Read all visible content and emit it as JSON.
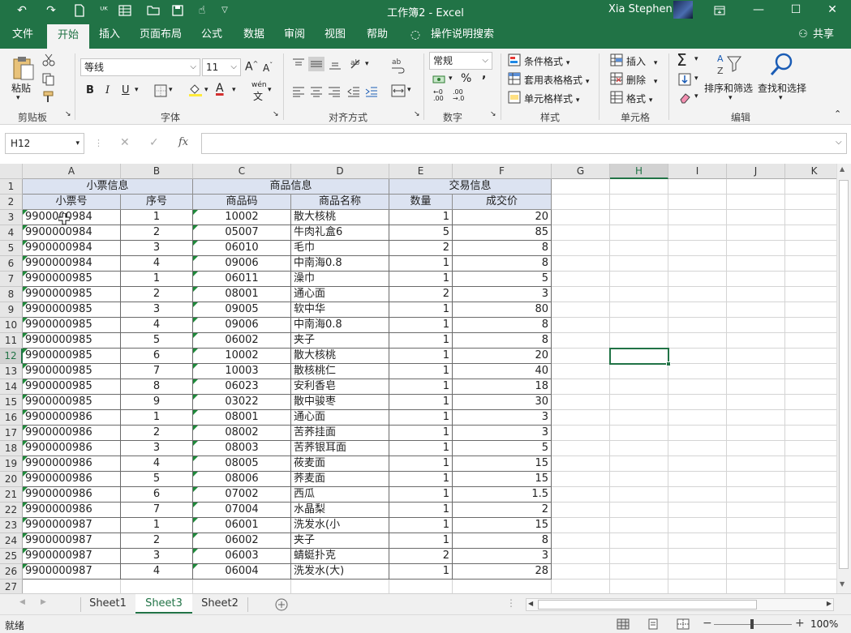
{
  "titlebar": {
    "title": "工作簿2  -  Excel",
    "user": "Xia Stephen",
    "minimize": "—",
    "restore": "☐",
    "close": "✕"
  },
  "tabs": [
    "文件",
    "开始",
    "插入",
    "页面布局",
    "公式",
    "数据",
    "审阅",
    "视图",
    "帮助"
  ],
  "tell_me": "操作说明搜索",
  "share": "共享",
  "ribbon": {
    "clipboard": {
      "paste": "粘贴",
      "label": "剪贴板"
    },
    "font": {
      "name": "等线",
      "size": "11",
      "label": "字体",
      "bold": "B",
      "italic": "I",
      "underline": "U",
      "grow": "A",
      "shrink": "A",
      "phonetic": "wén"
    },
    "alignment": {
      "label": "对齐方式"
    },
    "number": {
      "format": "常规",
      "label": "数字",
      "percent": "%",
      "comma": ",",
      "inc_dec": ".00",
      "dec_dec": ".00"
    },
    "styles": {
      "conditional": "条件格式",
      "table": "套用表格格式",
      "cell": "单元格样式",
      "label": "样式"
    },
    "cells": {
      "insert": "插入",
      "delete": "删除",
      "format": "格式",
      "label": "单元格"
    },
    "editing": {
      "sort": "排序和筛选",
      "find": "查找和选择",
      "label": "编辑"
    }
  },
  "formula_bar": {
    "name_box": "H12",
    "formula": ""
  },
  "columns": [
    "A",
    "B",
    "C",
    "D",
    "E",
    "F",
    "G",
    "H",
    "I",
    "J",
    "K"
  ],
  "selected_cell": "H12",
  "header_row1": [
    "小票信息",
    "商品信息",
    "交易信息"
  ],
  "header_row2": [
    "小票号",
    "序号",
    "商品码",
    "商品名称",
    "数量",
    "成交价"
  ],
  "rows": [
    [
      "9900000984",
      "1",
      "10002",
      "散大核桃",
      "1",
      "20"
    ],
    [
      "9900000984",
      "2",
      "05007",
      "牛肉礼盒6",
      "5",
      "85"
    ],
    [
      "9900000984",
      "3",
      "06010",
      "毛巾",
      "2",
      "8"
    ],
    [
      "9900000984",
      "4",
      "09006",
      "中南海0.8",
      "1",
      "8"
    ],
    [
      "9900000985",
      "1",
      "06011",
      "澡巾",
      "1",
      "5"
    ],
    [
      "9900000985",
      "2",
      "08001",
      "通心面",
      "2",
      "3"
    ],
    [
      "9900000985",
      "3",
      "09005",
      "软中华",
      "1",
      "80"
    ],
    [
      "9900000985",
      "4",
      "09006",
      "中南海0.8",
      "1",
      "8"
    ],
    [
      "9900000985",
      "5",
      "06002",
      "夹子",
      "1",
      "8"
    ],
    [
      "9900000985",
      "6",
      "10002",
      "散大核桃",
      "1",
      "20"
    ],
    [
      "9900000985",
      "7",
      "10003",
      "散核桃仁",
      "1",
      "40"
    ],
    [
      "9900000985",
      "8",
      "06023",
      "安利香皂",
      "1",
      "18"
    ],
    [
      "9900000985",
      "9",
      "03022",
      "散中骏枣",
      "1",
      "30"
    ],
    [
      "9900000986",
      "1",
      "08001",
      "通心面",
      "1",
      "3"
    ],
    [
      "9900000986",
      "2",
      "08002",
      "苦荞挂面",
      "1",
      "3"
    ],
    [
      "9900000986",
      "3",
      "08003",
      "苦荞银耳面",
      "1",
      "5"
    ],
    [
      "9900000986",
      "4",
      "08005",
      "莜麦面",
      "1",
      "15"
    ],
    [
      "9900000986",
      "5",
      "08006",
      "荞麦面",
      "1",
      "15"
    ],
    [
      "9900000986",
      "6",
      "07002",
      "西瓜",
      "1",
      "1.5"
    ],
    [
      "9900000986",
      "7",
      "07004",
      "水晶梨",
      "1",
      "2"
    ],
    [
      "9900000987",
      "1",
      "06001",
      "洗发水(小",
      "1",
      "15"
    ],
    [
      "9900000987",
      "2",
      "06002",
      "夹子",
      "1",
      "8"
    ],
    [
      "9900000987",
      "3",
      "06003",
      "蜻蜓扑克",
      "2",
      "3"
    ],
    [
      "9900000987",
      "4",
      "06004",
      "洗发水(大)",
      "1",
      "28"
    ]
  ],
  "row_numbers": [
    "1",
    "2",
    "3",
    "4",
    "5",
    "6",
    "7",
    "8",
    "9",
    "10",
    "11",
    "12",
    "13",
    "14",
    "15",
    "16",
    "17",
    "18",
    "19",
    "20",
    "21",
    "22",
    "23",
    "24",
    "25",
    "26",
    "27"
  ],
  "sheets": [
    "Sheet1",
    "Sheet3",
    "Sheet2"
  ],
  "active_sheet": "Sheet3",
  "status": {
    "ready": "就绪",
    "zoom": "100%",
    "minus": "−",
    "plus": "+"
  },
  "colors": {
    "accent": "#217346",
    "header_fill": "#dce3f1"
  }
}
